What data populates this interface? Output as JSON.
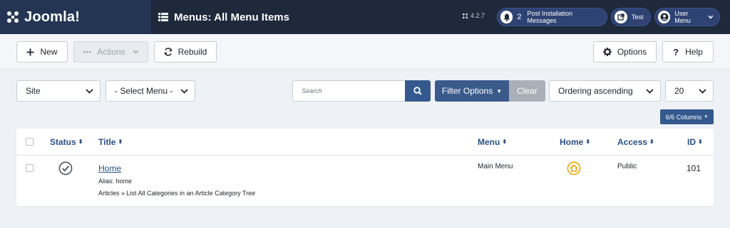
{
  "header": {
    "brand": "Joomla!",
    "page_title": "Menus: All Menu Items",
    "version": "4.2.7",
    "notifications_count": "2",
    "notifications_label": "Post Installation Messages",
    "test_label": "Test",
    "user_menu_label": "User Menu"
  },
  "toolbar": {
    "new_label": "New",
    "actions_label": "Actions",
    "rebuild_label": "Rebuild",
    "options_label": "Options",
    "help_label": "Help"
  },
  "filters": {
    "site_value": "Site",
    "menu_value": "- Select Menu -",
    "search_placeholder": "Search",
    "filter_options_label": "Filter Options",
    "clear_label": "Clear",
    "ordering_value": "Ordering ascending",
    "limit_value": "20",
    "columns_label": "6/6 Columns"
  },
  "table": {
    "headers": {
      "status": "Status",
      "title": "Title",
      "menu": "Menu",
      "home": "Home",
      "access": "Access",
      "id": "ID"
    },
    "rows": [
      {
        "title": "Home",
        "alias_label": "Alias:",
        "alias": "home",
        "type": "Articles » List All Categories in an Article Category Tree",
        "menu": "Main Menu",
        "access": "Public",
        "id": "101"
      }
    ]
  },
  "colors": {
    "header_bg": "#1e293b",
    "brand_bg": "#243554",
    "primary": "#34598e",
    "link": "#2a4f84",
    "home_star": "#f0a500"
  }
}
